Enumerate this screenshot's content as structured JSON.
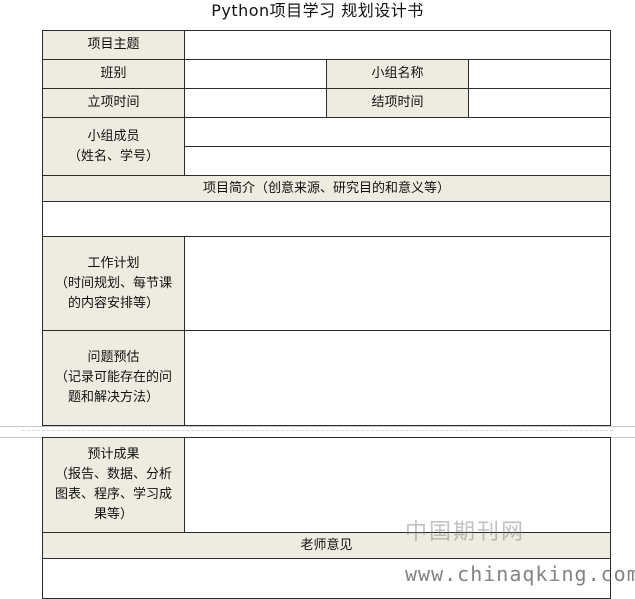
{
  "title": "Python项目学习 规划设计书",
  "form": {
    "project_topic_label": "项目主题",
    "class_label": "班别",
    "group_name_label": "小组名称",
    "start_time_label": "立项时间",
    "end_time_label": "结项时间",
    "members_label_line1": "小组成员",
    "members_label_line2": "（姓名、学号）",
    "intro_header": "项目简介（创意来源、研究目的和意义等）",
    "work_plan_label": {
      "line1": "工作计划",
      "line2": "（时间规划、每节课",
      "line3": "的内容安排等）"
    },
    "issues_label": {
      "line1": "问题预估",
      "line2": "（记录可能存在的问",
      "line3": "题和解决方法）"
    },
    "results_label": {
      "line1": "预计成果",
      "line2": "（报告、数据、分析",
      "line3": "图表、程序、学习成",
      "line4": "果等）"
    },
    "teacher_header": "老师意见"
  },
  "watermark": {
    "cn": "中国期刊网",
    "url": "www.chinaqking.com"
  }
}
